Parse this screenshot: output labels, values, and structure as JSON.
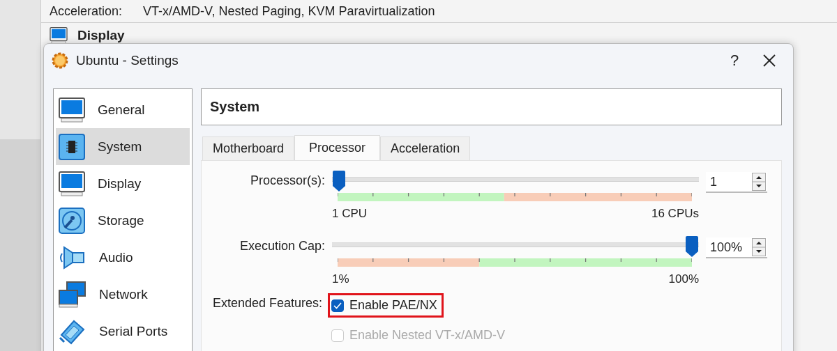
{
  "background_window": {
    "details": [
      {
        "label": "Acceleration:",
        "value": "VT-x/AMD-V, Nested Paging, KVM Paravirtualization"
      }
    ],
    "section_title": "Display"
  },
  "dialog": {
    "title": "Ubuntu - Settings",
    "help": "?"
  },
  "sidebar": {
    "items": [
      {
        "label": "General",
        "kind": "general",
        "selected": false
      },
      {
        "label": "System",
        "kind": "system",
        "selected": true
      },
      {
        "label": "Display",
        "kind": "display",
        "selected": false
      },
      {
        "label": "Storage",
        "kind": "storage",
        "selected": false
      },
      {
        "label": "Audio",
        "kind": "audio",
        "selected": false
      },
      {
        "label": "Network",
        "kind": "network",
        "selected": false
      },
      {
        "label": "Serial Ports",
        "kind": "serial",
        "selected": false
      }
    ]
  },
  "page_title": "System",
  "tabs": [
    {
      "label": "Motherboard",
      "selected": false
    },
    {
      "label": "Processor",
      "selected": true
    },
    {
      "label": "Acceleration",
      "selected": false
    }
  ],
  "sliders": [
    {
      "label": "Processor(s):",
      "level": 0,
      "value": "1",
      "min_label": "1 CPU",
      "max_label": "16 CPUs",
      "kind": "good-low"
    },
    {
      "label": "Execution Cap:",
      "level": 1,
      "value": "100%",
      "min_label": "1%",
      "max_label": "100%",
      "kind": "good-high"
    }
  ],
  "features": {
    "label": "Extended Features:",
    "options": [
      {
        "label": "Enable PAE/NX",
        "checked": true,
        "disabled": false,
        "highlighted": true
      },
      {
        "label": "Enable Nested VT-x/AMD-V",
        "checked": false,
        "disabled": true,
        "highlighted": false
      }
    ]
  }
}
